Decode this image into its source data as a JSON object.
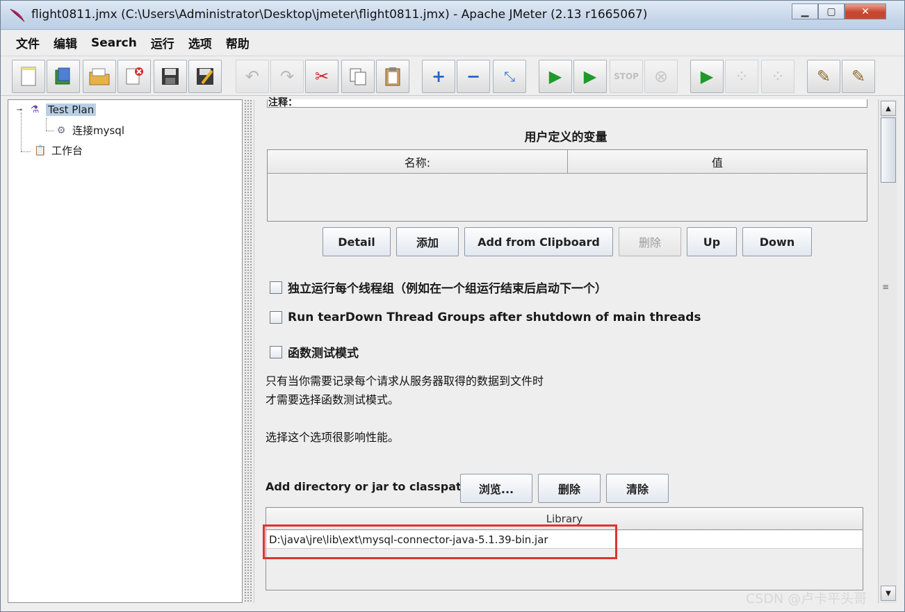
{
  "window": {
    "title": "flight0811.jmx (C:\\Users\\Administrator\\Desktop\\jmeter\\flight0811.jmx) - Apache JMeter (2.13 r1665067)",
    "minimize": "▭",
    "maximize": "▢",
    "close": "✕"
  },
  "menu": [
    "文件",
    "编辑",
    "Search",
    "运行",
    "选项",
    "帮助"
  ],
  "toolbar": {
    "icons": [
      "new-icon",
      "templates-icon",
      "open-icon",
      "close-file-icon",
      "save-icon",
      "save-as-icon",
      "undo-icon",
      "redo-icon",
      "cut-icon",
      "copy-icon",
      "paste-icon",
      "expand-icon",
      "collapse-icon",
      "toggle-icon",
      "start-icon",
      "start-no-pause-icon",
      "stop-icon",
      "shutdown-icon",
      "remote-start-icon",
      "remote-stop-icon",
      "remote-shutdown-icon",
      "clear-icon",
      "clear-all-icon"
    ]
  },
  "tree": {
    "root": "Test Plan",
    "child": "连接mysql",
    "workbench": "工作台"
  },
  "panel": {
    "comment_label": "注释：",
    "section_title": "用户定义的变量",
    "columns": [
      "名称:",
      "值"
    ],
    "buttons": {
      "detail": "Detail",
      "add": "添加",
      "add_clipboard": "Add from Clipboard",
      "delete": "删除",
      "up": "Up",
      "down": "Down"
    },
    "checkboxes": [
      "独立运行每个线程组（例如在一个组运行结束后启动下一个）",
      "Run tearDown Thread Groups after shutdown of main threads",
      "函数测试模式"
    ],
    "note_line1": "只有当你需要记录每个请求从服务器取得的数据到文件时",
    "note_line2": "才需要选择函数测试模式。",
    "note_line3": "选择这个选项很影响性能。",
    "classpath_label": "Add directory or jar to classpath",
    "classpath_buttons": {
      "browse": "浏览...",
      "delete": "删除",
      "clear": "清除"
    },
    "library_header": "Library",
    "library_rows": [
      "D:\\java\\jre\\lib\\ext\\mysql-connector-java-5.1.39-bin.jar"
    ]
  },
  "watermark": "CSDN @卢卡平头哥"
}
